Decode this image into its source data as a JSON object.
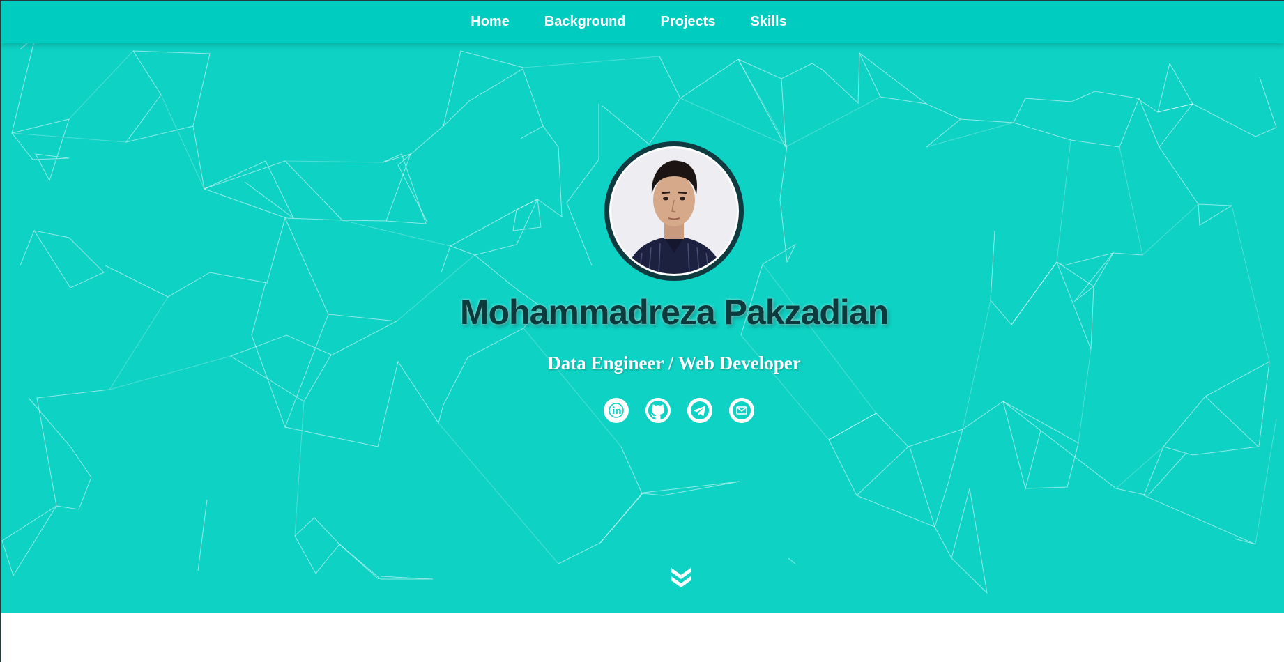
{
  "nav": {
    "items": [
      {
        "label": "Home"
      },
      {
        "label": "Background"
      },
      {
        "label": "Projects"
      },
      {
        "label": "Skills"
      }
    ]
  },
  "hero": {
    "name": "Mohammadreza Pakzadian",
    "subtitle": "Data Engineer / Web Developer",
    "avatar_icon": "profile-photo",
    "socials": [
      {
        "icon": "linkedin-icon"
      },
      {
        "icon": "github-icon"
      },
      {
        "icon": "telegram-icon"
      },
      {
        "icon": "email-icon"
      }
    ],
    "scroll_icon": "chevron-double-down-icon"
  },
  "colors": {
    "hero_background": "#0dd2c4",
    "navbar_background": "#00cdbf",
    "name_color": "#0d3a3d",
    "avatar_ring": "#0f3a3f",
    "text_white": "#ffffff"
  }
}
